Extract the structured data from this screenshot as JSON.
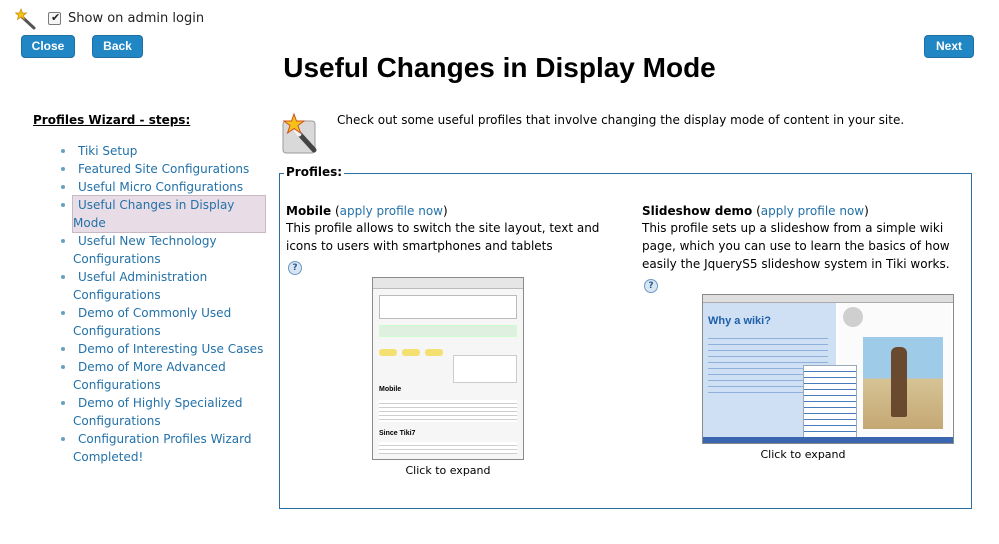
{
  "top": {
    "show_on_admin_login": "Show on admin login",
    "close_label": "Close",
    "back_label": "Back",
    "next_label": "Next"
  },
  "page_title": "Useful Changes in Display Mode",
  "sidebar": {
    "heading": "Profiles Wizard - steps:",
    "items": [
      {
        "label": "Tiki Setup",
        "active": false
      },
      {
        "label": "Featured Site Configurations",
        "active": false
      },
      {
        "label": "Useful Micro Configurations",
        "active": false
      },
      {
        "label": "Useful Changes in Display Mode",
        "active": true
      },
      {
        "label": "Useful New Technology Configurations",
        "active": false
      },
      {
        "label": "Useful Administration Configurations",
        "active": false
      },
      {
        "label": "Demo of Commonly Used Configurations",
        "active": false
      },
      {
        "label": "Demo of Interesting Use Cases",
        "active": false
      },
      {
        "label": "Demo of More Advanced Configurations",
        "active": false
      },
      {
        "label": "Demo of Highly Specialized Configurations",
        "active": false
      },
      {
        "label": "Configuration Profiles Wizard Completed!",
        "active": false
      }
    ]
  },
  "intro_text": "Check out some useful profiles that involve changing the display mode of content in your site.",
  "profiles": {
    "legend": "Profiles:",
    "mobile": {
      "name": "Mobile",
      "apply_open": "(",
      "apply_link": "apply profile now",
      "apply_close": ")",
      "description": "This profile allows to switch the site layout, text and icons to users with smartphones and tablets",
      "caption": "Click to expand",
      "shot_heading": "Mobile",
      "shot_sub": "Since Tiki7"
    },
    "slideshow": {
      "name": "Slideshow demo",
      "apply_open": "(",
      "apply_link": "apply profile now",
      "apply_close": ")",
      "description": "This profile sets up a slideshow from a simple wiki page, which you can use to learn the basics of how easily the JqueryS5 slideshow system in Tiki works.",
      "caption": "Click to expand",
      "shot_heading": "Why a wiki?"
    }
  },
  "colors": {
    "button": "#2186c4",
    "link": "#2371a8",
    "fieldset_border": "#2a6fa2",
    "active_step_bg": "#e8dde6"
  },
  "icons": {
    "wizard": "magic-wand-icon",
    "help": "help-icon"
  }
}
